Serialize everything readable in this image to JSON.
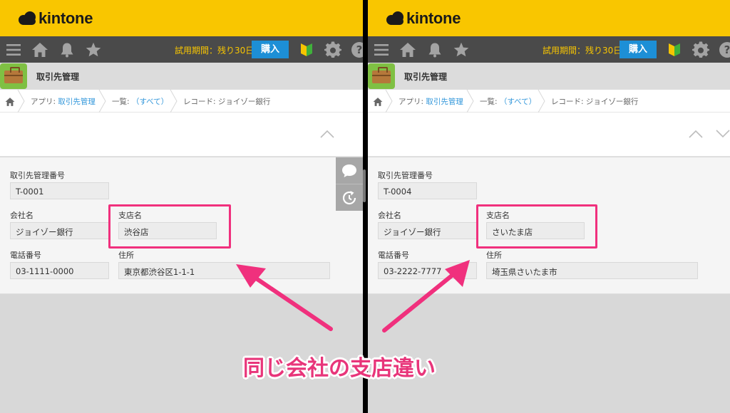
{
  "logo_text": "kintone",
  "toolbar": {
    "trial_text": "試用期間：残り30日",
    "buy_label": "購入"
  },
  "app": {
    "title": "取引先管理"
  },
  "breadcrumb": {
    "app_prefix": "アプリ: ",
    "app_link": "取引先管理",
    "list_prefix": "一覧: ",
    "list_link": "（すべて）",
    "record": "レコード: ジョイゾー銀行"
  },
  "labels": {
    "record_number": "取引先管理番号",
    "company": "会社名",
    "branch": "支店名",
    "phone": "電話番号",
    "address": "住所"
  },
  "records": [
    {
      "record_number": "T-0001",
      "company": "ジョイゾー銀行",
      "branch": "渋谷店",
      "phone": "03-1111-0000",
      "address": "東京都渋谷区1-1-1"
    },
    {
      "record_number": "T-0004",
      "company": "ジョイゾー銀行",
      "branch": "さいたま店",
      "phone": "03-2222-7777",
      "address": "埼玉県さいたま市"
    }
  ],
  "annotation": {
    "caption": "同じ会社の支店違い",
    "color": "#f0307d"
  },
  "colors": {
    "header_yellow": "#f9c600",
    "toolbar_gray": "#4a4a4a",
    "buy_blue": "#1d8fd6",
    "link_blue": "#3498db"
  }
}
